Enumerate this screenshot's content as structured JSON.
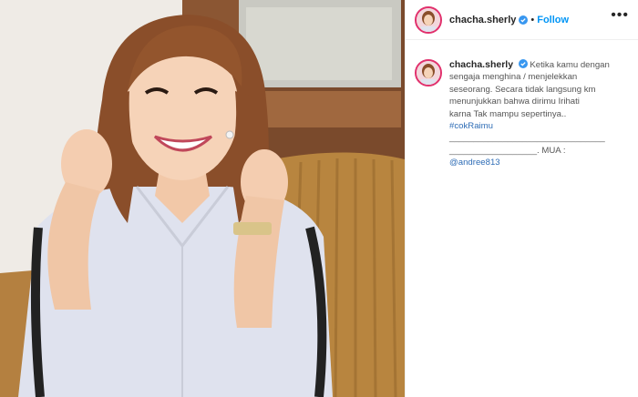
{
  "post": {
    "username": "chacha.sherly",
    "separator": "•",
    "follow_label": "Follow",
    "more_label": "•••"
  },
  "caption": {
    "username": "chacha.sherly",
    "lines": [
      "Ketika kamu dengan",
      "sengaja menghina / menjelekkan",
      "seseorang. Secara tidak langsung km",
      "menunjukkan bahwa dirimu Irihati",
      "karna Tak mampu sepertinya.."
    ],
    "hashtag": "#cokRaimu",
    "rule1": "________________________________",
    "rule2": "__________________. MUA :",
    "mention": "@andree813"
  },
  "colors": {
    "accent": "#0095f6",
    "link": "#2f6db6",
    "verified": "#3897f0",
    "ring": "#e1306c"
  },
  "icons": {
    "verified": "verified-badge-icon",
    "more": "more-options-icon"
  }
}
